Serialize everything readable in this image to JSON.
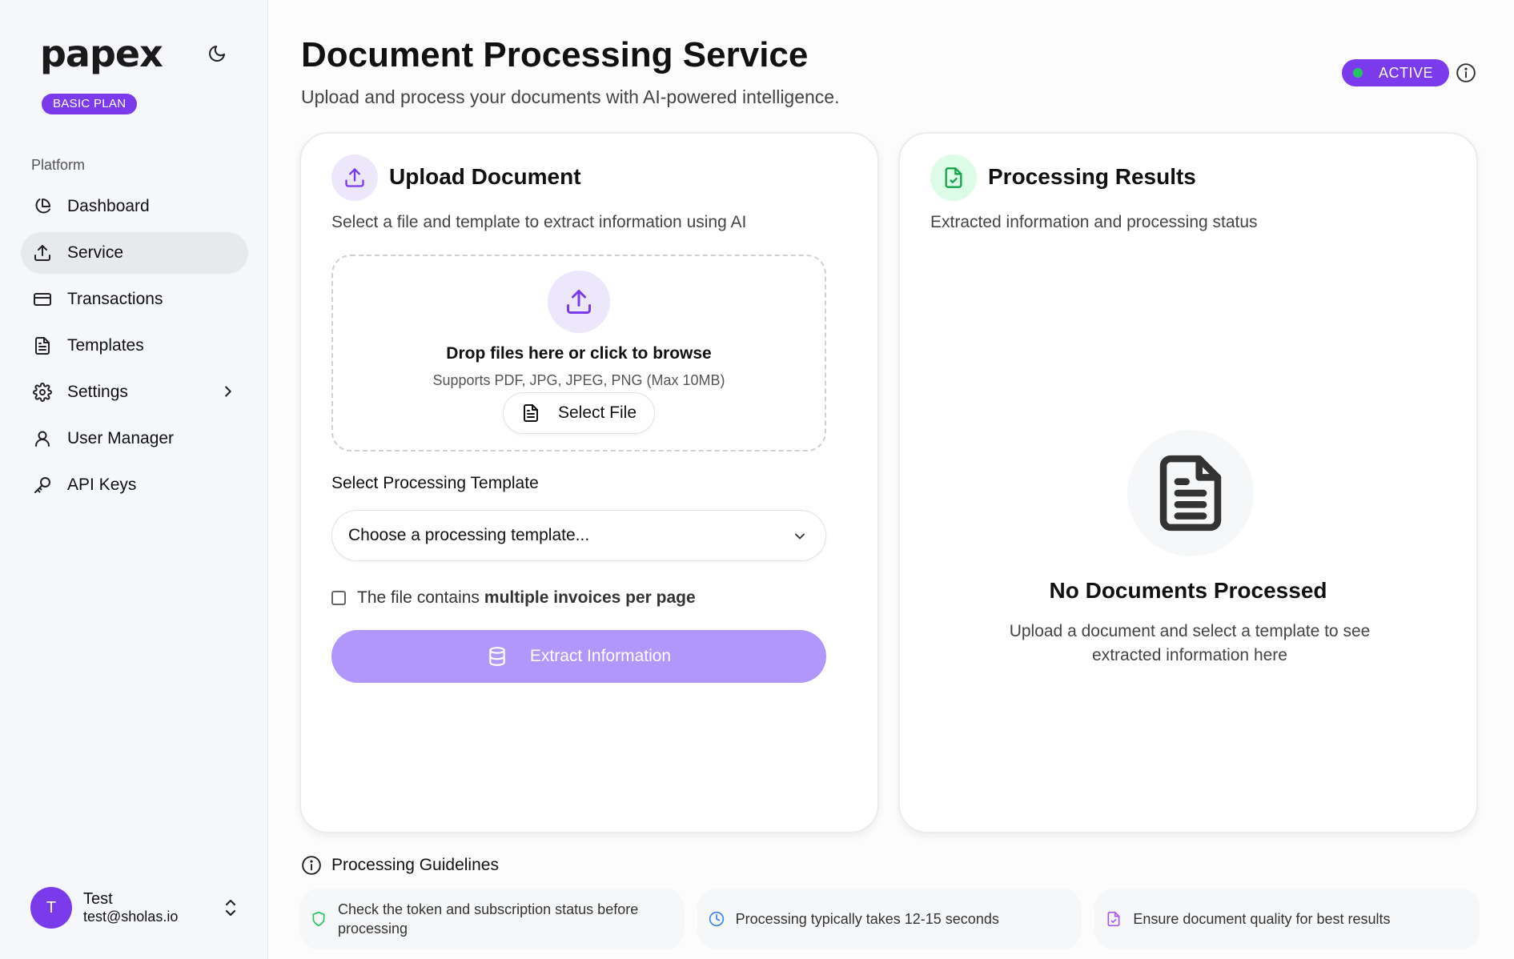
{
  "sidebar": {
    "logo": "papex",
    "plan_badge": "BASIC PLAN",
    "section_label": "Platform",
    "items": [
      {
        "label": "Dashboard",
        "icon": "pie-chart-icon"
      },
      {
        "label": "Service",
        "icon": "upload-icon",
        "active": true
      },
      {
        "label": "Transactions",
        "icon": "credit-card-icon"
      },
      {
        "label": "Templates",
        "icon": "document-icon"
      },
      {
        "label": "Settings",
        "icon": "gear-icon",
        "has_submenu": true
      },
      {
        "label": "User Manager",
        "icon": "user-icon"
      },
      {
        "label": "API Keys",
        "icon": "key-icon"
      }
    ],
    "user": {
      "initial": "T",
      "name": "Test",
      "email": "test@sholas.io"
    }
  },
  "header": {
    "title": "Document Processing Service",
    "subtitle": "Upload and process your documents with AI-powered intelligence.",
    "status": "ACTIVE"
  },
  "upload_card": {
    "title": "Upload Document",
    "subtitle": "Select a file and template to extract information using AI",
    "dropzone_title": "Drop files here or click to browse",
    "dropzone_sub": "Supports PDF, JPG, JPEG, PNG (Max 10MB)",
    "select_file": "Select File",
    "template_label": "Select Processing Template",
    "template_placeholder": "Choose a processing template...",
    "checkbox_prefix": "The file contains",
    "checkbox_bold": "multiple invoices per page",
    "extract_button": "Extract Information"
  },
  "results_card": {
    "title": "Processing Results",
    "subtitle": "Extracted information and processing status",
    "empty_title": "No Documents Processed",
    "empty_sub": "Upload a document and select a template to see extracted information here"
  },
  "guidelines": {
    "title": "Processing Guidelines",
    "items": [
      {
        "text": "Check the token and subscription status before processing",
        "icon": "shield-icon"
      },
      {
        "text": "Processing typically takes 12-15 seconds",
        "icon": "clock-icon"
      },
      {
        "text": "Ensure document quality for best results",
        "icon": "file-check-icon"
      }
    ]
  },
  "colors": {
    "accent": "#7c3aed",
    "accent_light": "#b197fc",
    "success": "#22c55e"
  }
}
